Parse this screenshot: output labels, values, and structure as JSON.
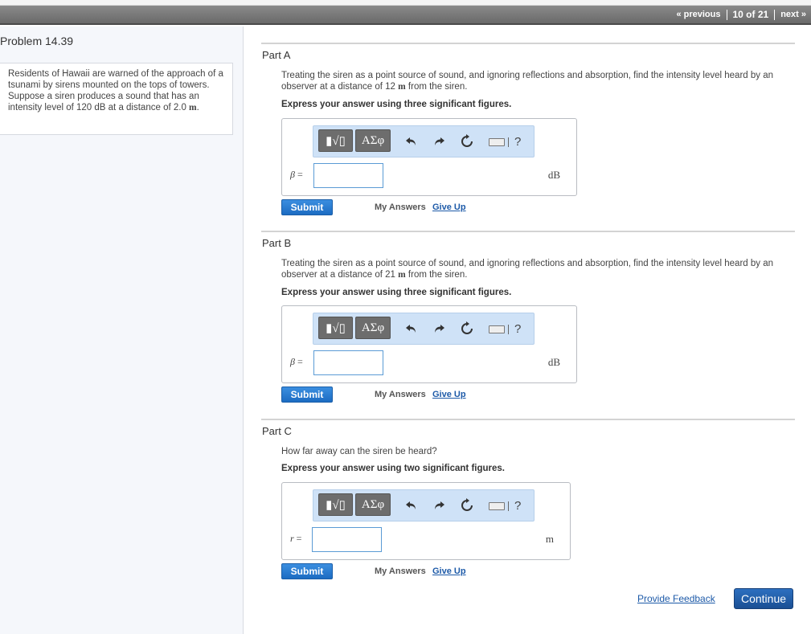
{
  "pager": {
    "previous_label": "« previous",
    "count": "10 of 21",
    "next_label": "next »"
  },
  "problem": {
    "title": "Problem 14.39",
    "text_before": "Residents of Hawaii are warned of the approach of a tsunami by sirens mounted on the tops of towers. Suppose a siren produces a sound that has an intensity level of 120 dB at a distance of 2.0 ",
    "unit": "m",
    "text_after": "."
  },
  "toolbar": {
    "template_label": "▮√▯",
    "symbols_label": "ΑΣφ",
    "help_label": "?"
  },
  "parts": [
    {
      "title": "Part A",
      "text_before": "Treating the siren as a point source of sound, and ignoring reflections and absorption, find the intensity level heard by an observer at a distance of 12 ",
      "unit_inline": "m",
      "text_after": " from the siren.",
      "instruction": "Express your answer using three significant figures.",
      "variable": "β",
      "equals": " =",
      "answer_value": "",
      "answer_unit": "dB",
      "submit_label": "Submit",
      "my_answers_label": "My Answers",
      "give_up_label": "Give Up"
    },
    {
      "title": "Part B",
      "text_before": "Treating the siren as a point source of sound, and ignoring reflections and absorption, find the intensity level heard by an observer at a distance of 21 ",
      "unit_inline": "m",
      "text_after": " from the siren.",
      "instruction": "Express your answer using three significant figures.",
      "variable": "β",
      "equals": " =",
      "answer_value": "",
      "answer_unit": "dB",
      "submit_label": "Submit",
      "my_answers_label": "My Answers",
      "give_up_label": "Give Up"
    },
    {
      "title": "Part C",
      "text_before": "How far away can the siren be heard?",
      "unit_inline": "",
      "text_after": "",
      "instruction": "Express your answer using two significant figures.",
      "variable": "r",
      "equals": " =",
      "answer_value": "",
      "answer_unit": "m",
      "submit_label": "Submit",
      "my_answers_label": "My Answers",
      "give_up_label": "Give Up"
    }
  ],
  "footer": {
    "feedback_label": "Provide Feedback",
    "continue_label": "Continue"
  }
}
